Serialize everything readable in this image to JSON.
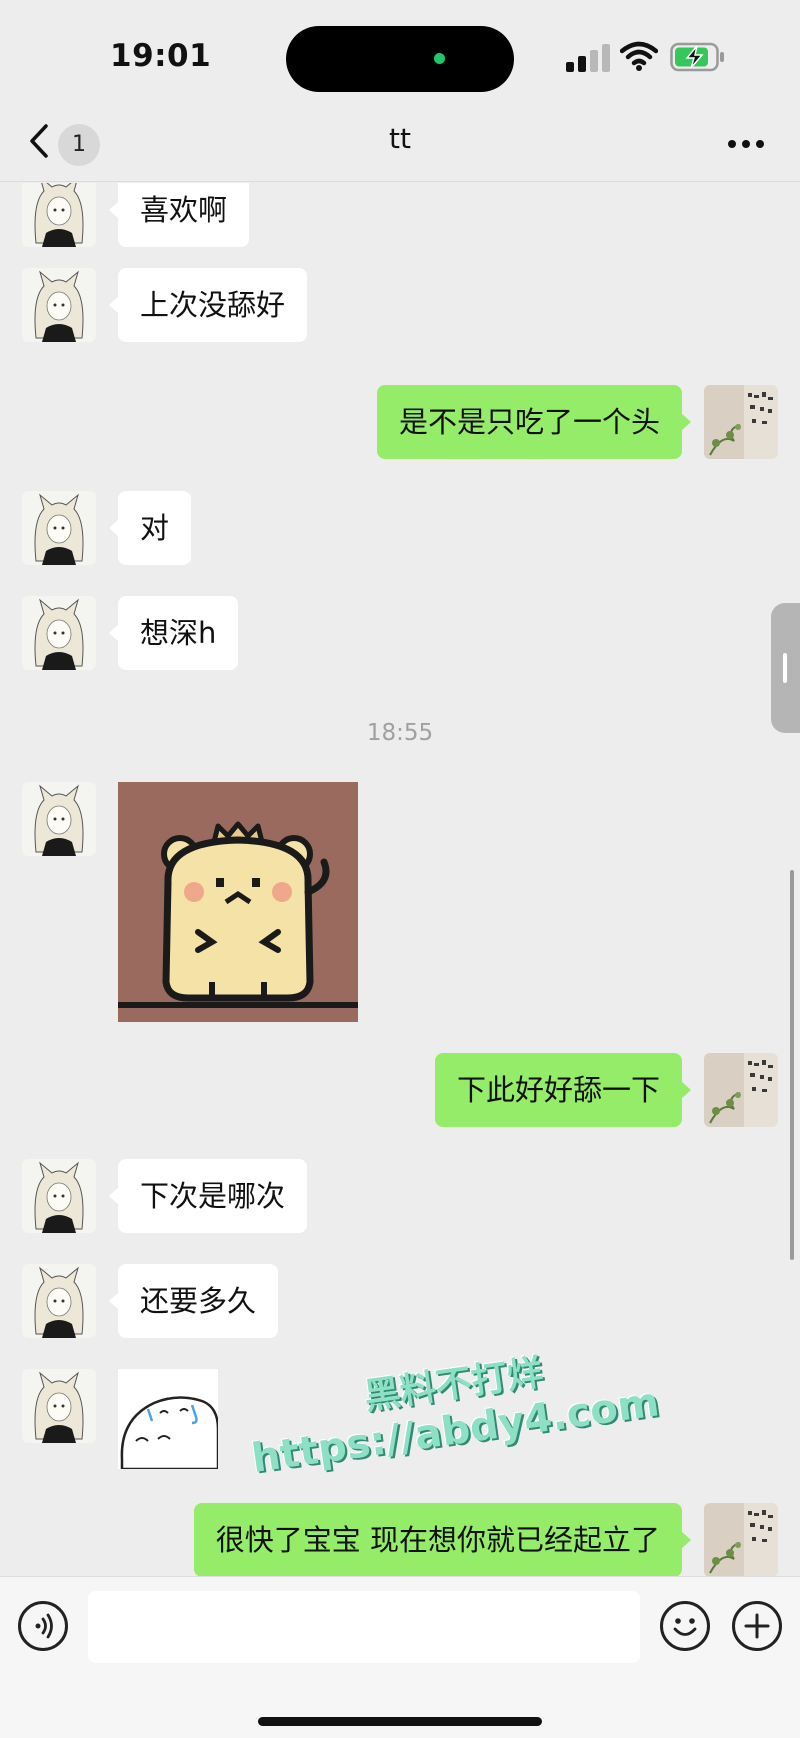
{
  "status_bar": {
    "time": "19:01",
    "icons": [
      "cellular-signal-icon",
      "wifi-icon",
      "battery-charging-icon"
    ]
  },
  "nav": {
    "back_icon": "chevron-left-icon",
    "unread_count": "1",
    "title": "tt",
    "more_icon": "more-dots-icon"
  },
  "messages": [
    {
      "side": "in",
      "text": "喜欢啊"
    },
    {
      "side": "in",
      "text": "上次没舔好"
    },
    {
      "side": "out",
      "text": "是不是只吃了一个头"
    },
    {
      "side": "in",
      "text": "对"
    },
    {
      "side": "in",
      "text": "想深h"
    },
    {
      "side": "time",
      "text": "18:55"
    },
    {
      "side": "in",
      "type": "sticker",
      "sticker": "bear-sticker"
    },
    {
      "side": "out",
      "text": "下此好好舔一下"
    },
    {
      "side": "in",
      "text": "下次是哪次"
    },
    {
      "side": "in",
      "text": "还要多久"
    },
    {
      "side": "in",
      "type": "sticker",
      "sticker": "blob-sticker"
    },
    {
      "side": "out",
      "text": "很快了宝宝 现在想你就已经起立了"
    }
  ],
  "watermark": {
    "line1": "黑料不打烊",
    "line2": "https://abdy4.com"
  },
  "input_bar": {
    "voice_icon": "voice-icon",
    "emoji_icon": "emoji-icon",
    "plus_icon": "plus-icon",
    "input_value": ""
  },
  "colors": {
    "background": "#ededed",
    "incoming_bubble": "#ffffff",
    "outgoing_bubble": "#95ec69",
    "timestamp_text": "#a0a0a0",
    "watermark": "#8ee0c4"
  }
}
